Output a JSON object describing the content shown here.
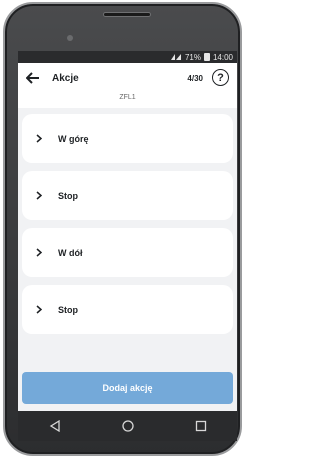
{
  "status": {
    "battery_percent": "71%",
    "time": "14:00"
  },
  "appbar": {
    "title": "Akcje",
    "counter": "4/30",
    "help_symbol": "?"
  },
  "device": {
    "label": "ZFL1"
  },
  "actions": [
    {
      "label": "W górę"
    },
    {
      "label": "Stop"
    },
    {
      "label": "W dół"
    },
    {
      "label": "Stop"
    }
  ],
  "add_button": {
    "label": "Dodaj akcję"
  },
  "colors": {
    "accent": "#74a9d9",
    "text": "#1e2124",
    "background": "#f1f2f4"
  },
  "icons": {
    "back": "arrow-left-icon",
    "help": "help-circle-icon",
    "chevron": "chevron-right-icon",
    "nav_back": "triangle-back-icon",
    "nav_home": "circle-home-icon",
    "nav_recents": "square-recents-icon"
  }
}
